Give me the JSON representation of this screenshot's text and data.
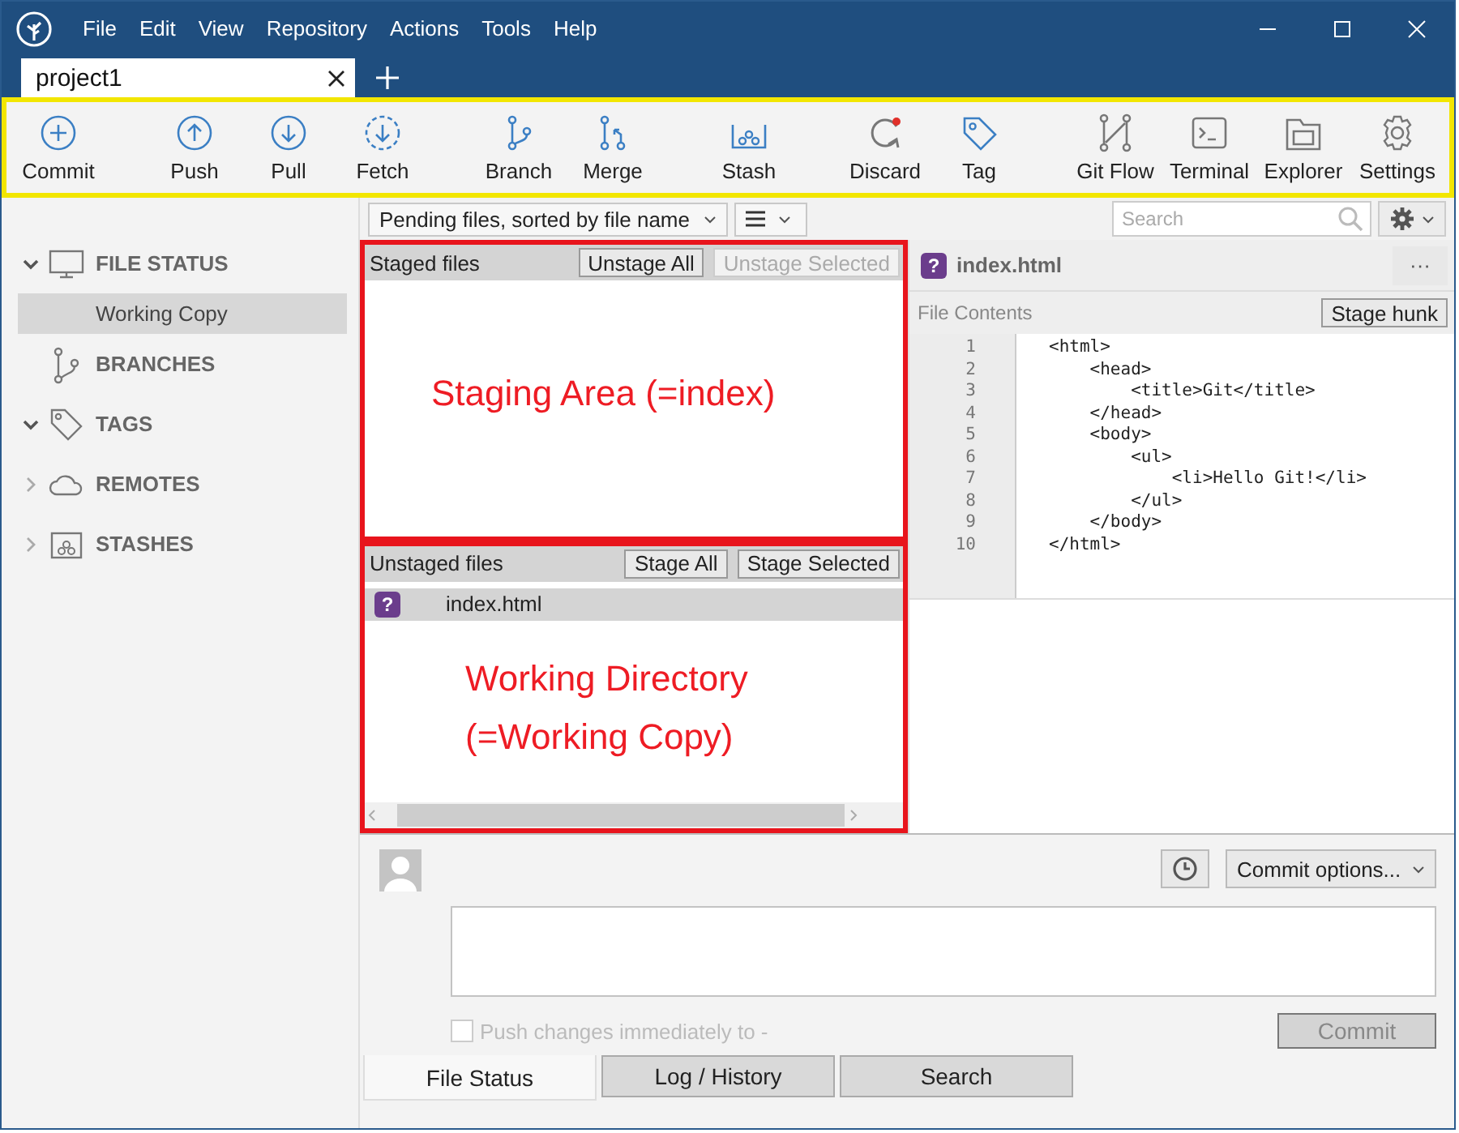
{
  "window": {
    "menu": [
      "File",
      "Edit",
      "View",
      "Repository",
      "Actions",
      "Tools",
      "Help"
    ]
  },
  "tabs": [
    {
      "label": "project1",
      "selected": true
    }
  ],
  "toolbar": {
    "groups": [
      [
        {
          "label": "Commit"
        }
      ],
      [
        {
          "label": "Push"
        },
        {
          "label": "Pull"
        },
        {
          "label": "Fetch"
        }
      ],
      [
        {
          "label": "Branch"
        },
        {
          "label": "Merge"
        }
      ],
      [
        {
          "label": "Stash"
        }
      ],
      [
        {
          "label": "Discard"
        },
        {
          "label": "Tag"
        }
      ],
      [
        {
          "label": "Git Flow"
        },
        {
          "label": "Terminal"
        },
        {
          "label": "Explorer"
        },
        {
          "label": "Settings"
        }
      ]
    ]
  },
  "sidebar": {
    "sections": [
      {
        "label": "FILE STATUS",
        "expanded": true,
        "children": [
          {
            "label": "Working Copy",
            "selected": true
          }
        ]
      },
      {
        "label": "BRANCHES"
      },
      {
        "label": "TAGS",
        "expanded": true
      },
      {
        "label": "REMOTES",
        "expanded": false
      },
      {
        "label": "STASHES",
        "expanded": false
      }
    ]
  },
  "file_list": {
    "sort": "Pending files, sorted by file name",
    "search": {
      "placeholder": "Search"
    }
  },
  "staged": {
    "title": "Staged files",
    "buttons": [
      {
        "label": "Unstage All",
        "disabled": false
      },
      {
        "label": "Unstage Selected",
        "disabled": true
      }
    ],
    "annotation": [
      "Staging Area (=index)"
    ]
  },
  "unstaged": {
    "title": "Unstaged files",
    "buttons": [
      {
        "label": "Stage All",
        "disabled": false
      },
      {
        "label": "Stage Selected",
        "disabled": false
      }
    ],
    "files": [
      {
        "name": "index.html",
        "status": "?",
        "selected": true
      }
    ],
    "annotation": [
      "Working Directory",
      "(=Working Copy)"
    ]
  },
  "diff": {
    "file": "index.html",
    "status": "?",
    "more": "···",
    "section": "File Contents",
    "button": "Stage hunk",
    "lines": [
      {
        "number": "1",
        "text": "<html>"
      },
      {
        "number": "2",
        "text": "    <head>"
      },
      {
        "number": "3",
        "text": "        <title>Git</title>"
      },
      {
        "number": "4",
        "text": "    </head>"
      },
      {
        "number": "5",
        "text": "    <body>"
      },
      {
        "number": "6",
        "text": "        <ul>"
      },
      {
        "number": "7",
        "text": "            <li>Hello Git!</li>"
      },
      {
        "number": "8",
        "text": "        </ul>"
      },
      {
        "number": "9",
        "text": "    </body>"
      },
      {
        "number": "10",
        "text": "</html>"
      }
    ]
  },
  "commit": {
    "options": "Commit options...",
    "push_option": {
      "label": "Push changes immediately to -",
      "checked": false,
      "disabled": true
    },
    "button": {
      "label": "Commit",
      "disabled": true
    }
  },
  "bottom_tabs": [
    {
      "label": "File Status",
      "selected": true
    },
    {
      "label": "Log / History",
      "selected": false
    },
    {
      "label": "Search",
      "selected": false
    }
  ]
}
